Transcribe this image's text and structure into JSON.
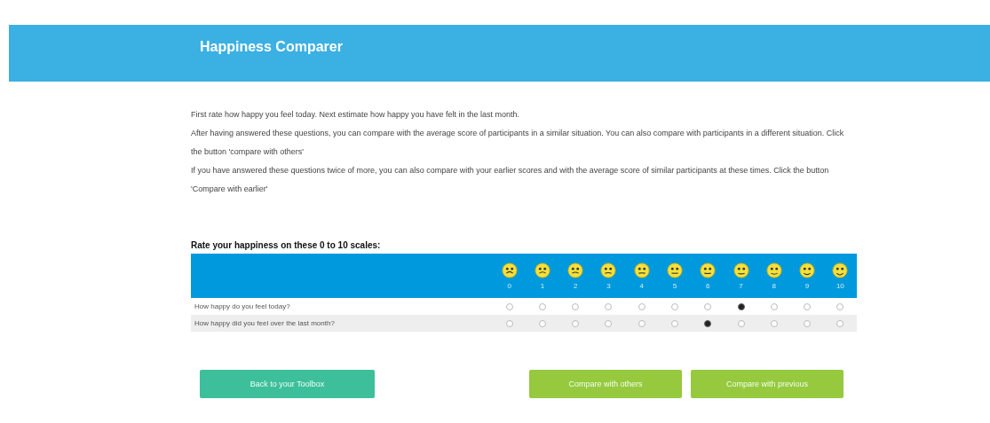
{
  "header": {
    "title": "Happiness Comparer"
  },
  "intro": [
    "First rate how happy you feel today. Next estimate how happy you have felt in the last month.",
    "After having answered these questions, you can compare with the average score of participants in a similar situation. You can also compare with participants in a different situation. Click the button 'compare with others'",
    "If you have answered these questions twice of more, you can also compare with your earlier scores and with the average score of similar participants at these times. Click the button 'Compare with earlier'"
  ],
  "scale": {
    "title": "Rate your happiness on these 0 to 10 scales:",
    "points": [
      "0",
      "1",
      "2",
      "3",
      "4",
      "5",
      "6",
      "7",
      "8",
      "9",
      "10"
    ],
    "questions": [
      {
        "label": "How happy do you feel today?",
        "options": [
          {
            "selected": false
          },
          {
            "selected": false
          },
          {
            "selected": false
          },
          {
            "selected": false
          },
          {
            "selected": false
          },
          {
            "selected": false
          },
          {
            "selected": false
          },
          {
            "selected": true
          },
          {
            "selected": false
          },
          {
            "selected": false
          },
          {
            "selected": false
          }
        ]
      },
      {
        "label": "How happy did you feel over the last month?",
        "options": [
          {
            "selected": false
          },
          {
            "selected": false
          },
          {
            "selected": false
          },
          {
            "selected": false
          },
          {
            "selected": false
          },
          {
            "selected": false
          },
          {
            "selected": true
          },
          {
            "selected": false
          },
          {
            "selected": false
          },
          {
            "selected": false
          },
          {
            "selected": false
          }
        ]
      }
    ]
  },
  "buttons": [
    {
      "label": "Back to your Toolbox",
      "kind": "back"
    },
    {
      "label": "Compare with others",
      "kind": "compare"
    },
    {
      "label": "Compare with previous",
      "kind": "compare"
    }
  ]
}
